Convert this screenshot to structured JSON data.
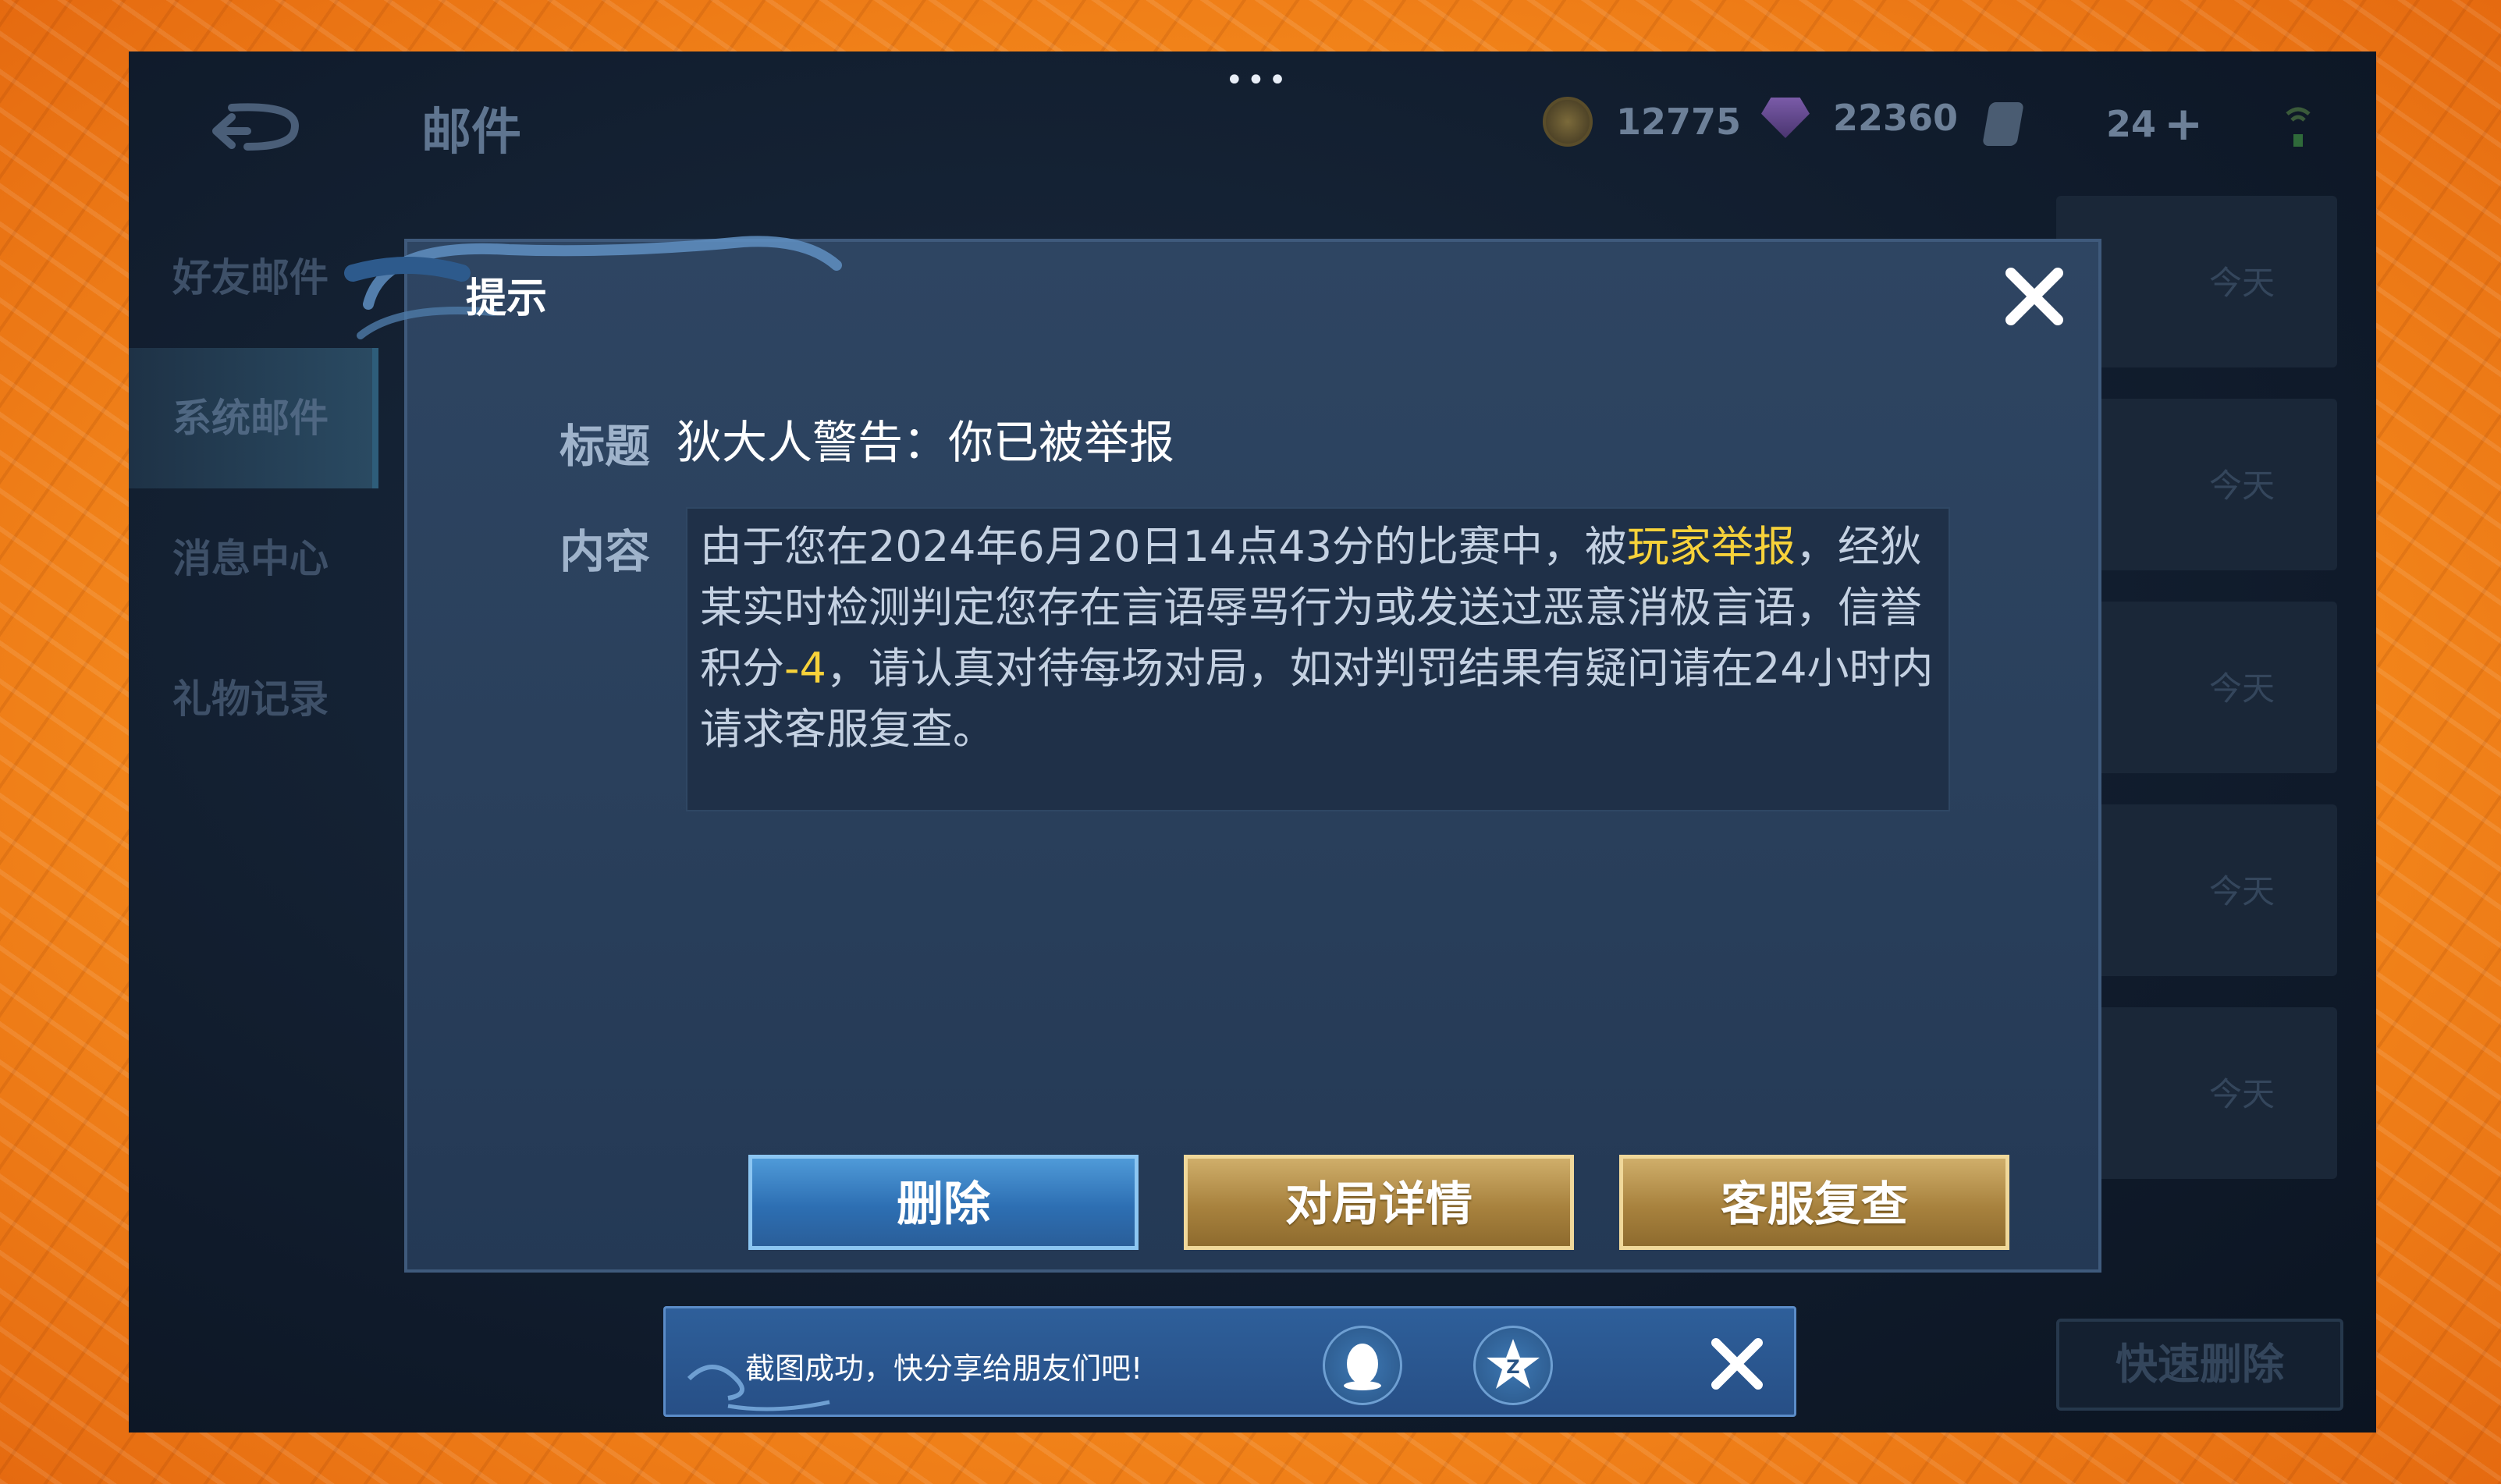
{
  "top_bar": {
    "more_dots": "•••",
    "title": "邮件",
    "gold": "12775",
    "diamonds": "22360",
    "tickets": "24",
    "plus": "+"
  },
  "left_menu": {
    "items": [
      {
        "label": "好友邮件"
      },
      {
        "label": "系统邮件"
      },
      {
        "label": "消息中心"
      },
      {
        "label": "礼物记录"
      }
    ]
  },
  "mail_list": {
    "rows": [
      {
        "date": "今天"
      },
      {
        "date": "今天"
      },
      {
        "date": "今天"
      },
      {
        "date": "今天"
      },
      {
        "date": "今天"
      }
    ],
    "quick_delete_label": "快速删除"
  },
  "dialog": {
    "title": "提示",
    "subject_label": "标题",
    "subject": "狄大人警告：你已被举报",
    "content_label": "内容",
    "content": {
      "part1": "由于您在2024年6月20日14点43分的比赛中，被",
      "highlight1": "玩家举报",
      "part2": "，经狄某实时检测判定您存在言语辱骂行为或发送过恶意消极言语，信誉积分",
      "highlight2": "-4",
      "part3": "，请认真对待每场对局，如对判罚结果有疑问请在24小时内请求客服复查。"
    },
    "buttons": {
      "delete": "删除",
      "match_details": "对局详情",
      "support_review": "客服复查"
    }
  },
  "toast": {
    "message": "截图成功，快分享给朋友们吧!"
  },
  "colors": {
    "highlight": "#f7d23a",
    "dialog_bg": "#2a405c",
    "button_blue": "#2d6fb3",
    "button_gold": "#a8823e"
  }
}
